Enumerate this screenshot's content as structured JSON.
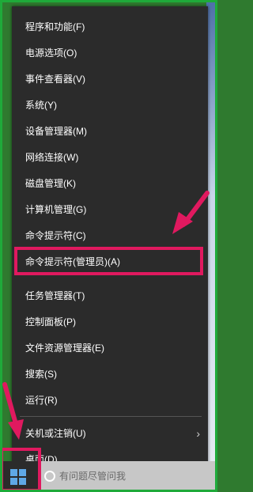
{
  "menu": {
    "items": [
      {
        "label": "程序和功能(F)"
      },
      {
        "label": "电源选项(O)"
      },
      {
        "label": "事件查看器(V)"
      },
      {
        "label": "系统(Y)"
      },
      {
        "label": "设备管理器(M)"
      },
      {
        "label": "网络连接(W)"
      },
      {
        "label": "磁盘管理(K)"
      },
      {
        "label": "计算机管理(G)"
      },
      {
        "label": "命令提示符(C)"
      },
      {
        "label": "命令提示符(管理员)(A)"
      },
      {
        "label": "任务管理器(T)"
      },
      {
        "label": "控制面板(P)"
      },
      {
        "label": "文件资源管理器(E)"
      },
      {
        "label": "搜索(S)"
      },
      {
        "label": "运行(R)"
      },
      {
        "label": "关机或注销(U)"
      },
      {
        "label": "桌面(D)"
      }
    ],
    "submenu_icon": "chevron-right-icon",
    "highlighted_item": "命令提示符(管理员)(A)"
  },
  "taskbar": {
    "start_icon": "windows-logo-icon",
    "search_icon": "search-icon",
    "search_placeholder": "有问题尽管问我"
  },
  "colors": {
    "menu_background": "#2b2b2b",
    "menu_text": "#ffffff",
    "annotation": "#e0195f",
    "frame_border": "#1faa3a"
  }
}
